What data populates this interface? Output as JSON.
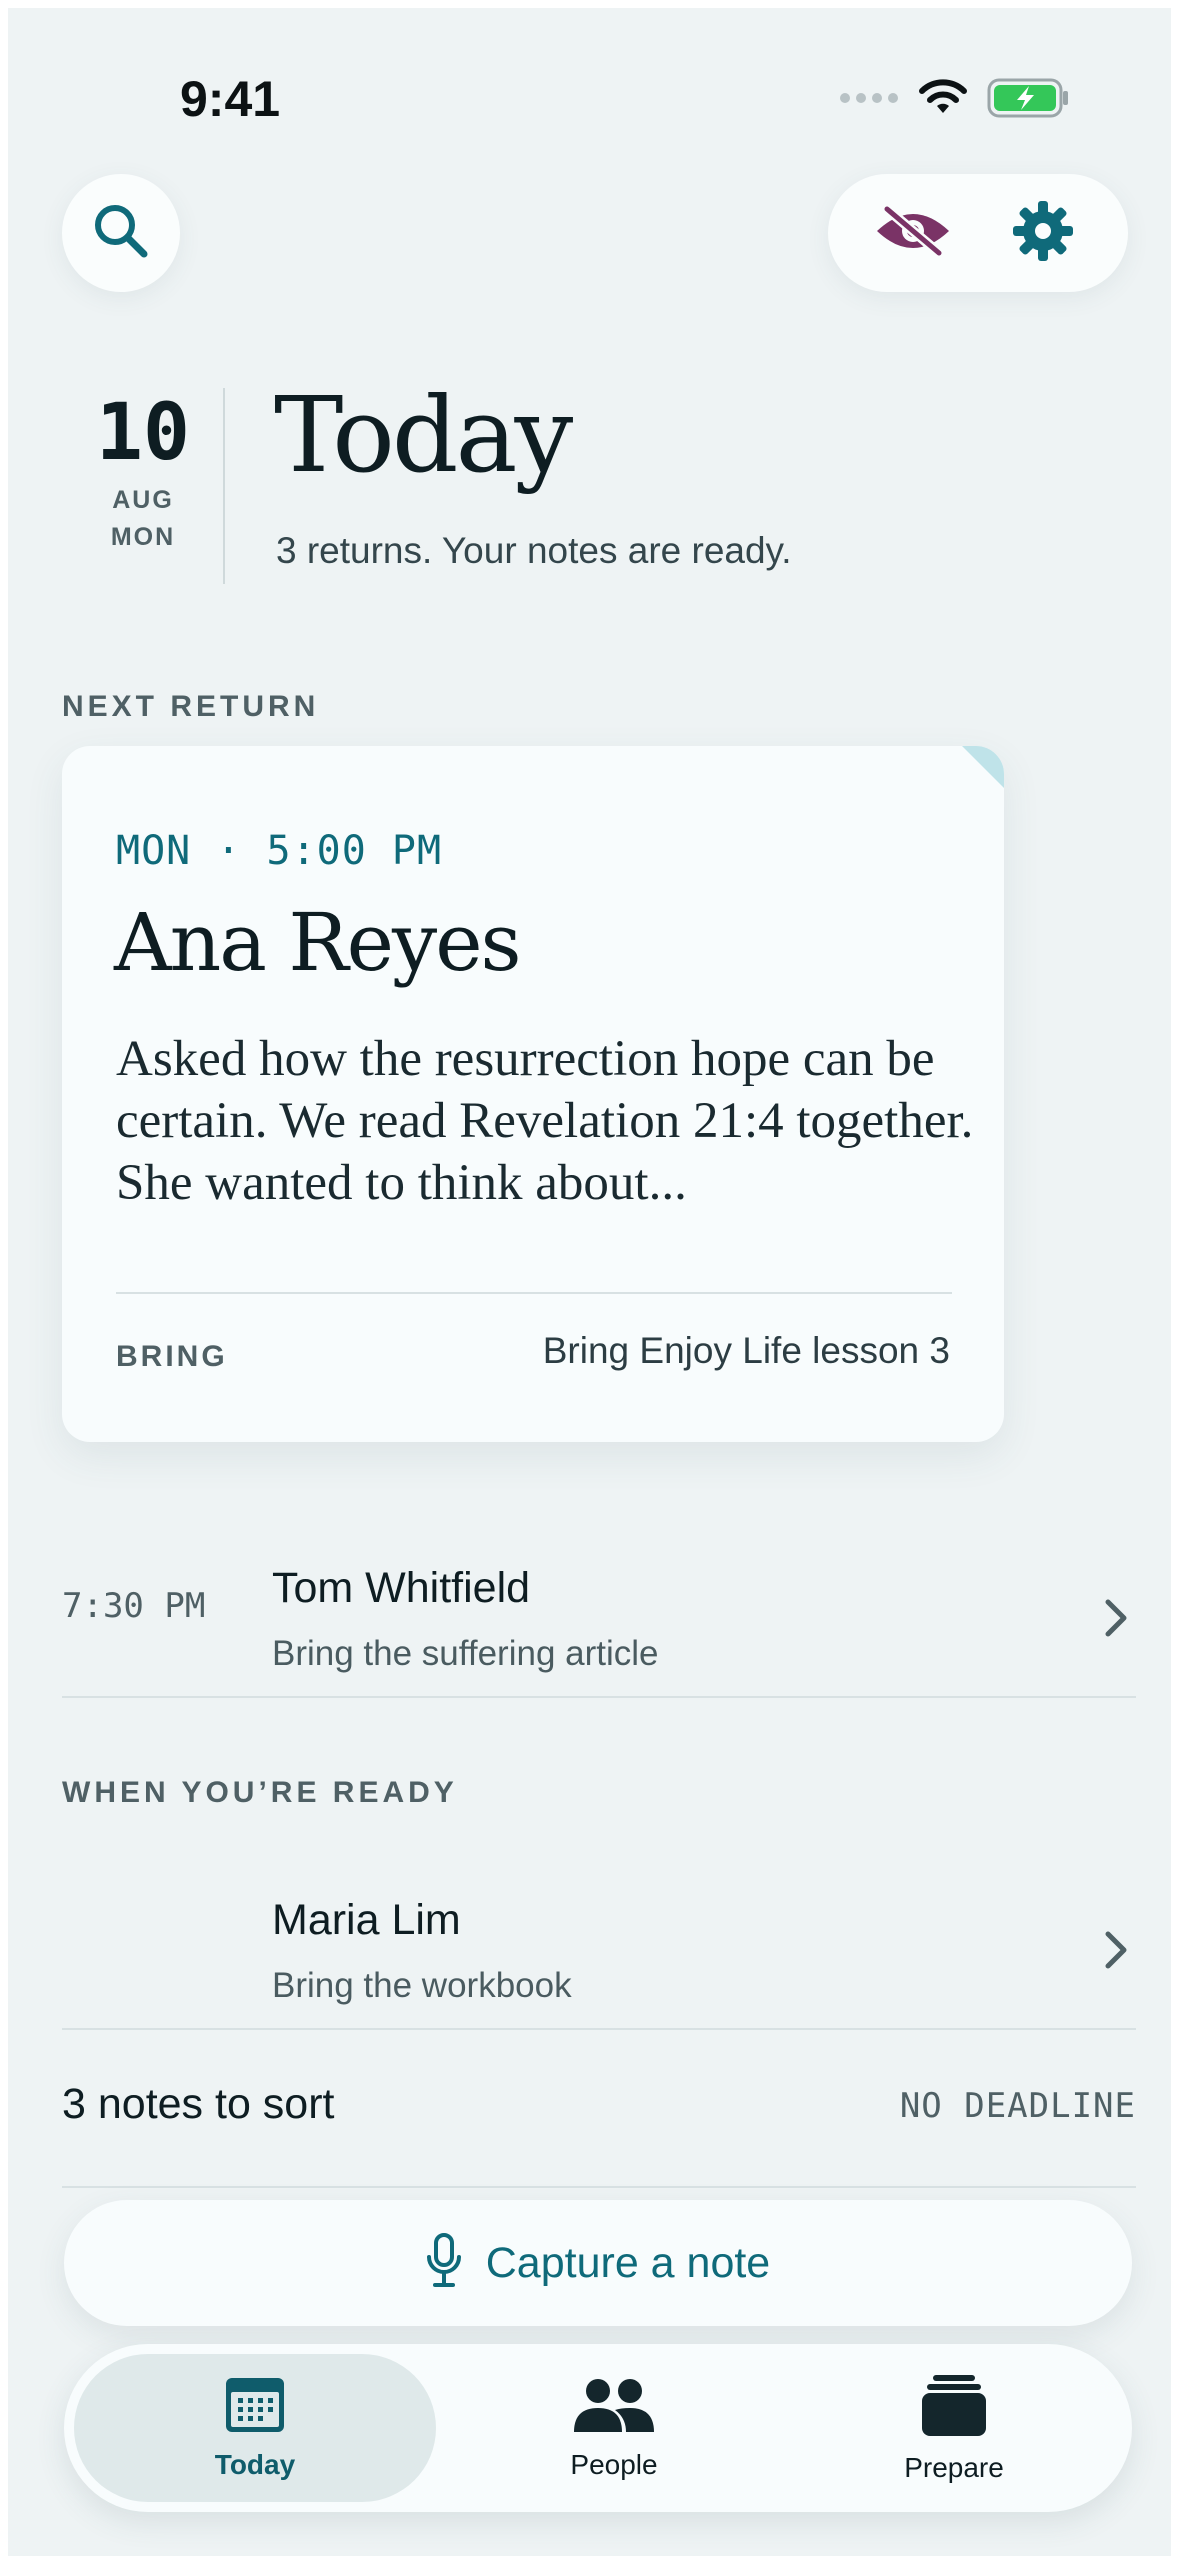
{
  "status_bar": {
    "time": "9:41"
  },
  "header": {
    "date_day": "10",
    "date_month": "AUG",
    "date_weekday": "MON",
    "title": "Today",
    "subtitle": "3 returns. Your notes are ready."
  },
  "sections": {
    "next_return": "NEXT RETURN",
    "when_ready": "WHEN YOU’RE READY"
  },
  "featured": {
    "time": "MON · 5:00 PM",
    "name": "Ana Reyes",
    "note": "Asked how the resurrection hope can be certain. We read Revelation 21:4 together. She wanted to think about...",
    "bring_label": "BRING",
    "bring_value": "Bring Enjoy Life lesson 3"
  },
  "upcoming": [
    {
      "time": "7:30 PM",
      "name": "Tom Whitfield",
      "sub": "Bring the suffering article"
    }
  ],
  "ready": [
    {
      "name": "Maria Lim",
      "sub": "Bring the workbook"
    }
  ],
  "sort": {
    "label": "3 notes to sort",
    "deadline": "NO DEADLINE"
  },
  "capture": {
    "label": "Capture a note"
  },
  "tabs": [
    {
      "label": "Today",
      "icon": "calendar-icon",
      "active": true
    },
    {
      "label": "People",
      "icon": "people-icon",
      "active": false
    },
    {
      "label": "Prepare",
      "icon": "stack-icon",
      "active": false
    }
  ],
  "colors": {
    "accent": "#0f6a7a",
    "privacy_icon": "#7a3366",
    "background": "#eef3f4",
    "card": "#f8fcfd"
  }
}
